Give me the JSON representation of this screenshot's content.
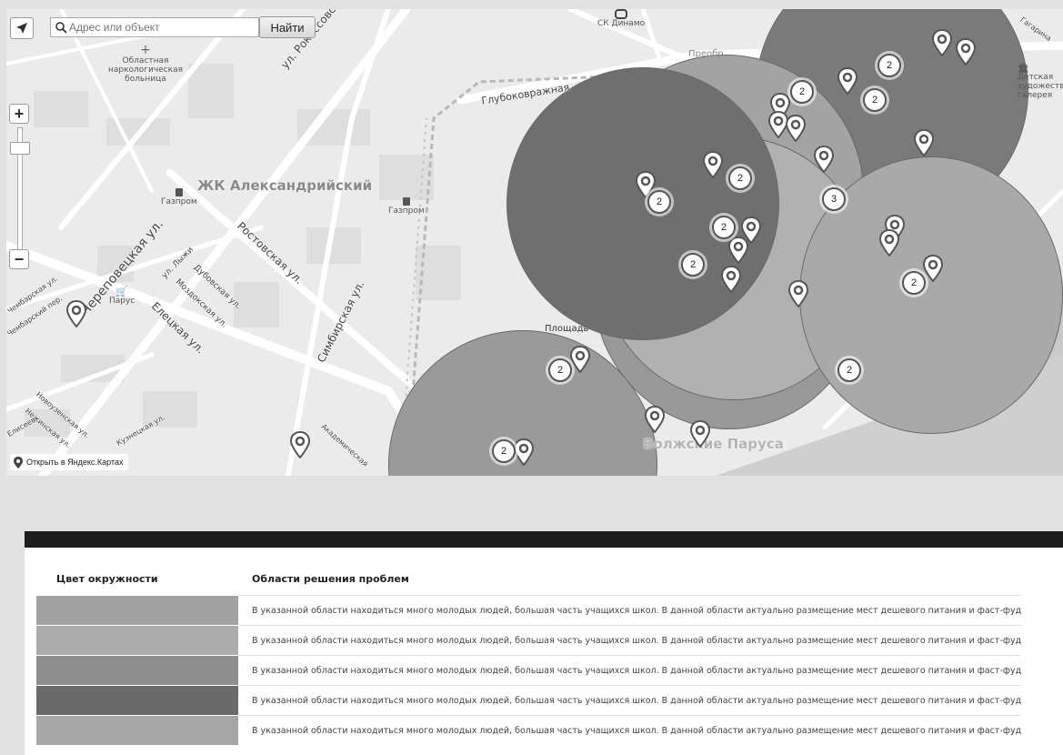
{
  "map": {
    "search_placeholder": "Адрес или объект",
    "search_button": "Найти",
    "open_in_yandex": "Открыть в Яндекс.Картах",
    "zoom_in": "+",
    "zoom_out": "−",
    "streets": {
      "rokossovskogo": "ул. Рокоссовского",
      "glubokovrazhnaya": "Глубоковражная",
      "cherepovetskaya": "Череповецкая ул.",
      "rostovskaya": "Ростовская ул.",
      "simbirskaya": "Симбирская ул.",
      "eletskaya": "Елецкая ул.",
      "lyzhy": "ул. Лыжи",
      "dubovskaya": "Дубовская ул.",
      "mozdokskaya": "Моздокская ул.",
      "chembarskaya1": "Чембарская ул.",
      "chembarskiy": "Чембарский пер.",
      "novouzenskaya": "Новоузенская ул.",
      "nezhinskaya": "Нежинская ул.",
      "kuznetskaya": "Кузнецкая ул.",
      "akademicheskaya": "Академическая",
      "gagarina": "Гагарина",
      "eliseev": "Елисеев"
    },
    "pois": {
      "hospital": "Областная наркологическая больница",
      "gazprom1": "Газпром",
      "gazprom2": "Газпром",
      "parus": "Парус",
      "dinamo": "СК Динамо",
      "gallery": "Детская художественная галерея",
      "ploshad": "Площадь",
      "preobr": "Преобр"
    },
    "districts": {
      "aleksandriyskiy": "ЖК Александрийский",
      "volzhskie": "Волжские Паруса"
    },
    "circles": [
      {
        "name": "circle-a",
        "color": "#7a7a7a"
      },
      {
        "name": "circle-b",
        "color": "#a3a3a3"
      },
      {
        "name": "circle-c",
        "color": "#999999"
      },
      {
        "name": "circle-d",
        "color": "#b1b1b1"
      },
      {
        "name": "circle-e",
        "color": "#a9a9a9"
      },
      {
        "name": "circle-f",
        "color": "#6f6f6f"
      },
      {
        "name": "circle-g",
        "color": "#9a9a9a"
      }
    ],
    "clusters": [
      "2",
      "2",
      "2",
      "2",
      "2",
      "3",
      "2",
      "2",
      "2",
      "2",
      "2",
      "2"
    ]
  },
  "table": {
    "headers": [
      "Цвет окружности",
      "Области решения проблем"
    ],
    "rows": [
      {
        "color": "#a2a2a2",
        "text": "В указанной области находиться много молодых людей, большая часть учащихся школ. В данной области актуально размещение мест дешевого питания и фаст-фуд"
      },
      {
        "color": "#acacac",
        "text": "В указанной области находиться много молодых людей, большая часть учащихся школ. В данной области актуально размещение мест дешевого питания и фаст-фуд"
      },
      {
        "color": "#8e8e8e",
        "text": "В указанной области находиться много молодых людей, большая часть учащихся школ. В данной области актуально размещение мест дешевого питания и фаст-фуд"
      },
      {
        "color": "#6a6a6a",
        "text": "В указанной области находиться много молодых людей, большая часть учащихся школ. В данной области актуально размещение мест дешевого питания и фаст-фуд"
      },
      {
        "color": "#a6a6a6",
        "text": "В указанной области находиться много молодых людей, большая часть учащихся школ. В данной области актуально размещение мест дешевого питания и фаст-фуд"
      }
    ]
  }
}
